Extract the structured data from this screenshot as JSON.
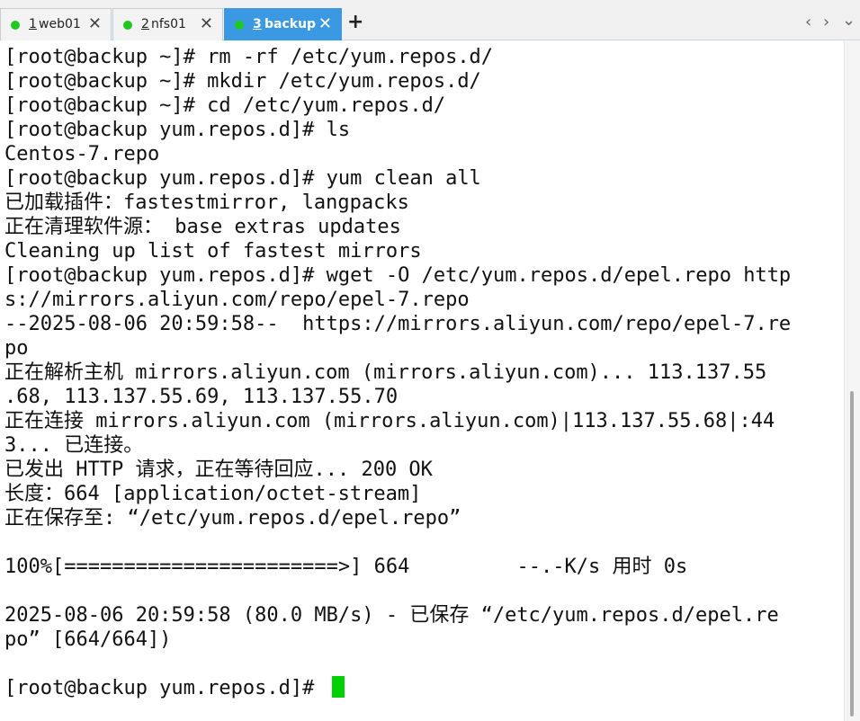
{
  "tabs": [
    {
      "number": "1",
      "label": "web01",
      "close": "✕"
    },
    {
      "number": "2",
      "label": "nfs01",
      "close": "✕"
    },
    {
      "number": "3",
      "label": "backup",
      "close": "✕"
    }
  ],
  "tab_bar": {
    "new_tab": "+",
    "prev": "‹",
    "next": "›",
    "menu": "⌄"
  },
  "terminal": {
    "lines": [
      "[root@backup ~]# rm -rf /etc/yum.repos.d/",
      "[root@backup ~]# mkdir /etc/yum.repos.d/",
      "[root@backup ~]# cd /etc/yum.repos.d/",
      "[root@backup yum.repos.d]# ls",
      "Centos-7.repo",
      "[root@backup yum.repos.d]# yum clean all",
      "已加载插件：fastestmirror, langpacks",
      "正在清理软件源： base extras updates",
      "Cleaning up list of fastest mirrors",
      "[root@backup yum.repos.d]# wget -O /etc/yum.repos.d/epel.repo http",
      "s://mirrors.aliyun.com/repo/epel-7.repo",
      "--2025-08-06 20:59:58--  https://mirrors.aliyun.com/repo/epel-7.re",
      "po",
      "正在解析主机 mirrors.aliyun.com (mirrors.aliyun.com)... 113.137.55",
      ".68, 113.137.55.69, 113.137.55.70",
      "正在连接 mirrors.aliyun.com (mirrors.aliyun.com)|113.137.55.68|:44",
      "3... 已连接。",
      "已发出 HTTP 请求，正在等待回应... 200 OK",
      "长度：664 [application/octet-stream]",
      "正在保存至: “/etc/yum.repos.d/epel.repo”",
      "",
      "100%[=======================>] 664         --.-K/s 用时 0s",
      "",
      "2025-08-06 20:59:58 (80.0 MB/s) - 已保存 “/etc/yum.repos.d/epel.re",
      "po” [664/664])",
      "",
      "[root@backup yum.repos.d]# "
    ]
  },
  "colors": {
    "active_tab": "#3b99e3",
    "status_dot": "#1ec81e",
    "cursor": "#00d100"
  }
}
